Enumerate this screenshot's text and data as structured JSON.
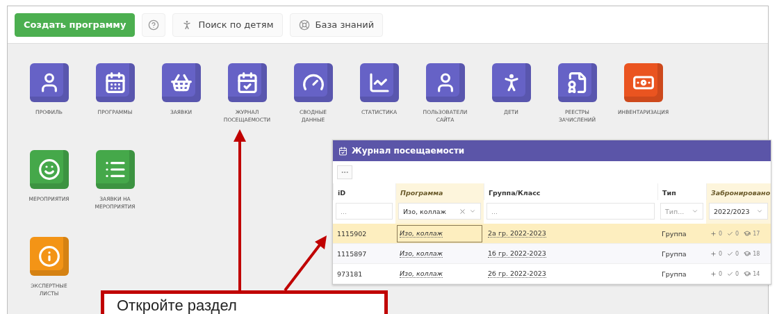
{
  "toolbar": {
    "buttons": [
      {
        "kind": "primary",
        "label": "Создать программу"
      },
      {
        "kind": "help"
      },
      {
        "kind": "child",
        "label": "Поиск по детям"
      },
      {
        "kind": "knowledge",
        "label": "База знаний"
      }
    ]
  },
  "tiles": [
    [
      {
        "label": "ПРОФИЛЬ",
        "kind": "user",
        "color": "#6662c6"
      },
      {
        "label": "ПРОГРАММЫ",
        "kind": "calendar",
        "color": "#6662c6"
      },
      {
        "label": "ЗАЯВКИ",
        "kind": "basket",
        "color": "#6662c6"
      },
      {
        "label": "ЖУРНАЛ\nПОСЕЩАЕМОСТИ",
        "kind": "calendar-check",
        "color": "#6662c6"
      },
      {
        "label": "СВОДНЫЕ\nДАННЫЕ",
        "kind": "gauge",
        "color": "#6662c6"
      },
      {
        "label": "СТАТИСТИКА",
        "kind": "chart",
        "color": "#6662c6"
      },
      {
        "label": "ПОЛЬЗОВАТЕЛИ\nСАЙТА",
        "kind": "user",
        "color": "#6662c6"
      },
      {
        "label": "ДЕТИ",
        "kind": "child",
        "color": "#6662c6"
      },
      {
        "label": "РЕЕСТРЫ\nЗАЧИСЛЕНИЙ",
        "kind": "certificate",
        "color": "#6662c6"
      },
      {
        "label": "ИНВЕНТАРИЗАЦИЯ",
        "kind": "banknote",
        "color": "#ea5420"
      }
    ],
    [
      {
        "label": "МЕРОПРИЯТИЯ",
        "kind": "smile",
        "color": "#45a84a"
      },
      {
        "label": "ЗАЯВКИ НА\nМЕРОПРИЯТИЯ",
        "kind": "list",
        "color": "#45a84a"
      }
    ],
    [
      {
        "label": "ЭКСПЕРТНЫЕ\nЛИСТЫ",
        "kind": "info",
        "color": "#f39416"
      }
    ]
  ],
  "panel": {
    "title": "Журнал посещаемости",
    "columns": [
      {
        "label": "iD",
        "filtered": false,
        "filter": {
          "placeholder": "...",
          "dropdown": false
        }
      },
      {
        "label": "Программа",
        "filtered": true,
        "filter": {
          "value": "Изо, коллаж",
          "clearable": true,
          "dropdown": true
        }
      },
      {
        "label": "Группа/Класс",
        "filtered": false,
        "filter": {
          "placeholder": "...",
          "dropdown": false
        }
      },
      {
        "label": "Тип",
        "filtered": false,
        "filter": {
          "placeholder": "Тип...",
          "dropdown": true
        }
      },
      {
        "label": "Забронировано",
        "filtered": true,
        "filter": {
          "value": "2022/2023",
          "dropdown": true
        }
      }
    ],
    "rows": [
      {
        "selected": true,
        "id": "1115902",
        "program": "Изо, коллаж",
        "group": "2а гр. 2022-2023",
        "type": "Группа",
        "added": "0",
        "confirmed": "0",
        "students": "17"
      },
      {
        "selected": false,
        "id": "1115897",
        "program": "Изо, коллаж",
        "group": "1б гр. 2022-2023",
        "type": "Группа",
        "added": "0",
        "confirmed": "0",
        "students": "18"
      },
      {
        "selected": false,
        "id": "973181",
        "program": "Изо, коллаж",
        "group": "2б гр. 2022-2023",
        "type": "Группа",
        "added": "0",
        "confirmed": "0",
        "students": "14"
      }
    ]
  },
  "callout": {
    "text": "Откройте раздел"
  }
}
